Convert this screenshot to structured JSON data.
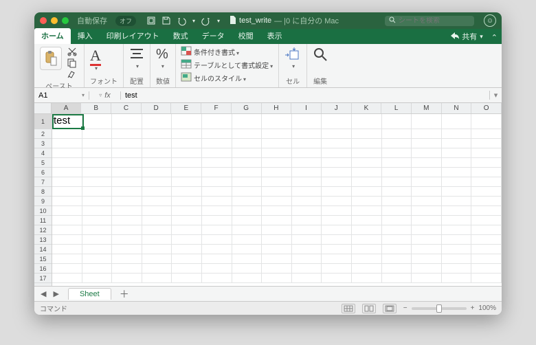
{
  "titlebar": {
    "autosave": "自動保存",
    "autosave_state": "オフ",
    "doc_name": "test_write",
    "doc_suffix": "— |0 に自分の Mac",
    "search_placeholder": "シートを検索"
  },
  "tabs": {
    "items": [
      "ホーム",
      "挿入",
      "印刷レイアウト",
      "数式",
      "データ",
      "校閲",
      "表示"
    ],
    "share": "共有"
  },
  "ribbon": {
    "paste": "ペースト",
    "font": "フォント",
    "align": "配置",
    "number": "数値",
    "percent": "%",
    "styles": {
      "cond": "条件付き書式",
      "table": "テーブルとして書式設定",
      "cell": "セルのスタイル"
    },
    "cells": "セル",
    "editing": "編集"
  },
  "formula": {
    "namebox": "A1",
    "fx": "fx",
    "value": "test"
  },
  "grid": {
    "cols": [
      "A",
      "B",
      "C",
      "D",
      "E",
      "F",
      "G",
      "H",
      "I",
      "J",
      "K",
      "L",
      "M",
      "N",
      "O"
    ],
    "rows": [
      1,
      2,
      3,
      4,
      5,
      6,
      7,
      8,
      9,
      10,
      11,
      12,
      13,
      14,
      15,
      16,
      17
    ],
    "A1": "test"
  },
  "sheetbar": {
    "sheet": "Sheet"
  },
  "status": {
    "label": "コマンド",
    "zoom": "100%"
  }
}
